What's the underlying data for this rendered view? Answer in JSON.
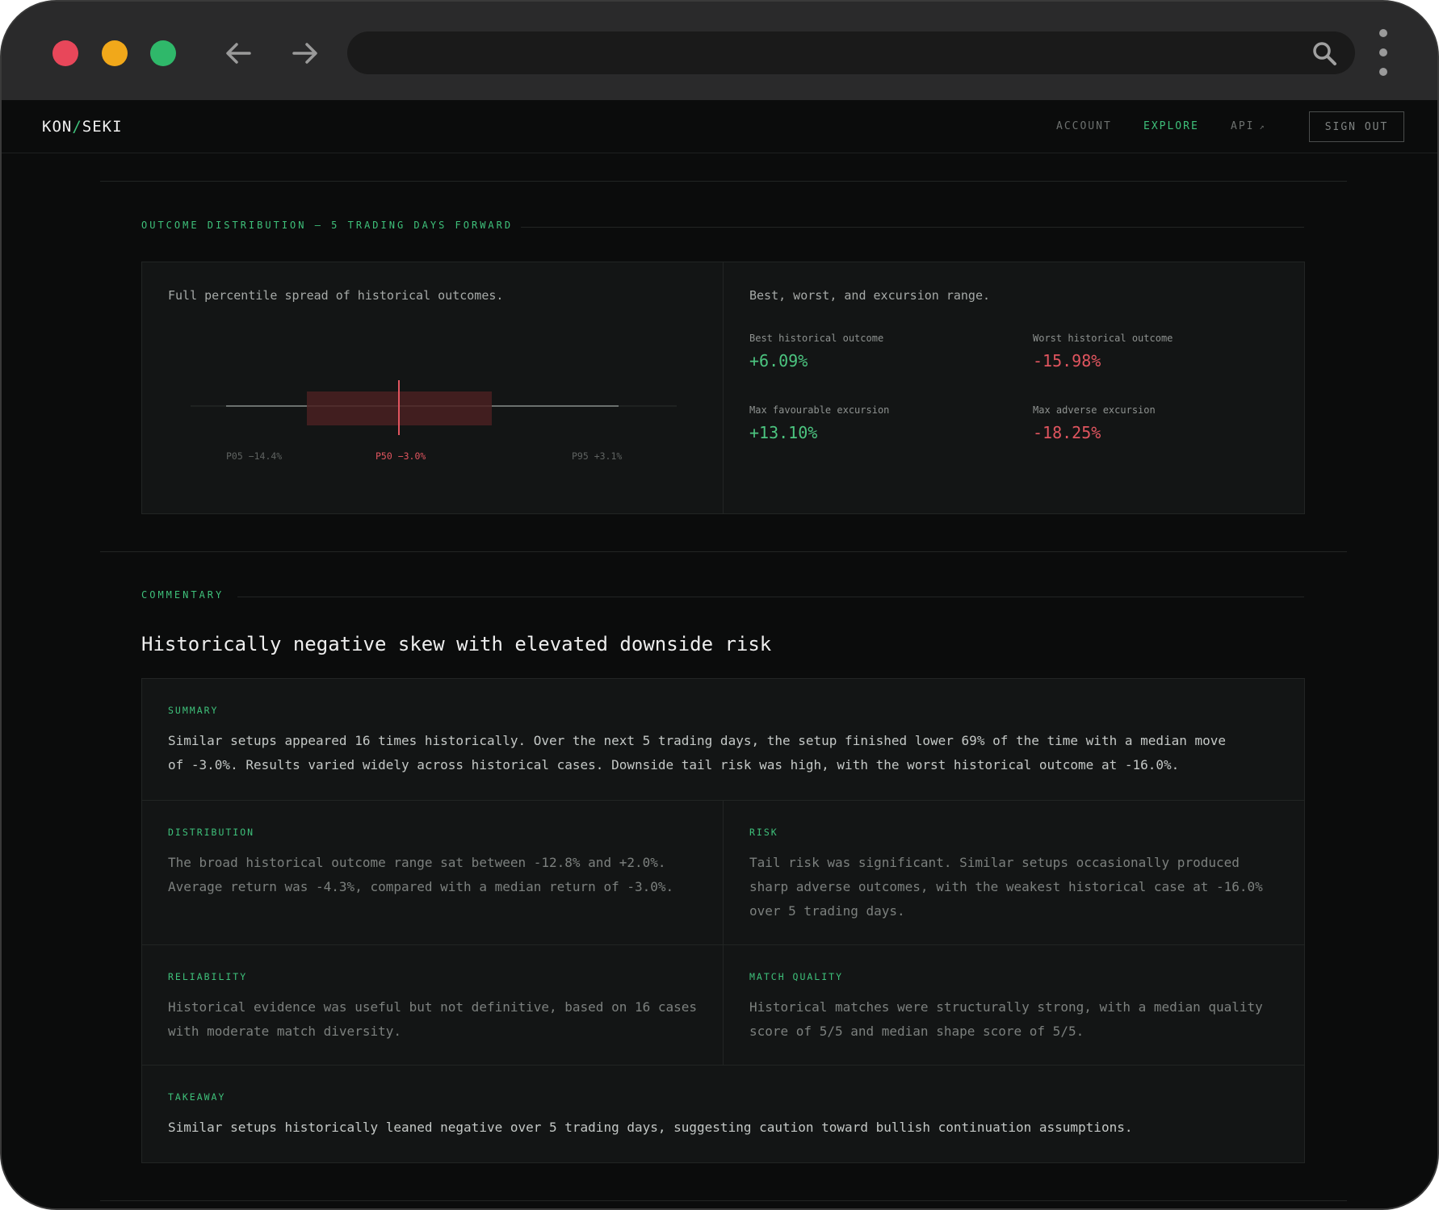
{
  "app": {
    "logo_left": "KON",
    "logo_slash": "/",
    "logo_right": "SEKI",
    "nav": {
      "account": "ACCOUNT",
      "explore": "EXPLORE",
      "api": "API",
      "api_ext": "↗",
      "signout": "SIGN OUT"
    }
  },
  "outcome": {
    "label": "OUTCOME DISTRIBUTION — 5 TRADING DAYS FORWARD",
    "left_desc": "Full percentile spread of historical outcomes.",
    "right_desc": "Best, worst, and excursion range.",
    "percentiles": {
      "p05": "P05 −14.4%",
      "p50": "P50 −3.0%",
      "p95": "P95 +3.1%"
    },
    "stats": {
      "best_label": "Best historical outcome",
      "best_value": "+6.09%",
      "worst_label": "Worst historical outcome",
      "worst_value": "-15.98%",
      "mfe_label": "Max favourable excursion",
      "mfe_value": "+13.10%",
      "mae_label": "Max adverse excursion",
      "mae_value": "-18.25%"
    },
    "colors": {
      "positive": "#4cc580",
      "negative": "#e0555f",
      "accent": "#3ec07a"
    }
  },
  "commentary": {
    "label": "COMMENTARY",
    "heading": "Historically negative skew with elevated downside risk",
    "summary": {
      "label": "SUMMARY",
      "line1": "Similar setups appeared 16 times historically. Over the next 5 trading days, the setup finished lower 69% of the time with a median move",
      "line2": "of -3.0%. Results varied widely across historical cases. Downside tail risk was high, with the worst historical outcome at -16.0%."
    },
    "distribution": {
      "label": "DISTRIBUTION",
      "line1": "The broad historical outcome range sat between -12.8% and +2.0%.",
      "line2": "Average return was -4.3%, compared with a median return of -3.0%."
    },
    "risk": {
      "label": "RISK",
      "line1": "Tail risk was significant. Similar setups occasionally produced",
      "line2": "sharp adverse outcomes, with the weakest historical case at -16.0%",
      "line3": "over 5 trading days."
    },
    "reliability": {
      "label": "RELIABILITY",
      "line1": "Historical evidence was useful but not definitive, based on 16 cases",
      "line2": "with moderate match diversity."
    },
    "match_quality": {
      "label": "MATCH QUALITY",
      "line1": "Historical matches were structurally strong, with a median quality",
      "line2": "score of 5/5 and median shape score of 5/5."
    },
    "takeaway": {
      "label": "TAKEAWAY",
      "line1": "Similar setups historically leaned negative over 5 trading days, suggesting caution toward bullish continuation assumptions."
    }
  }
}
